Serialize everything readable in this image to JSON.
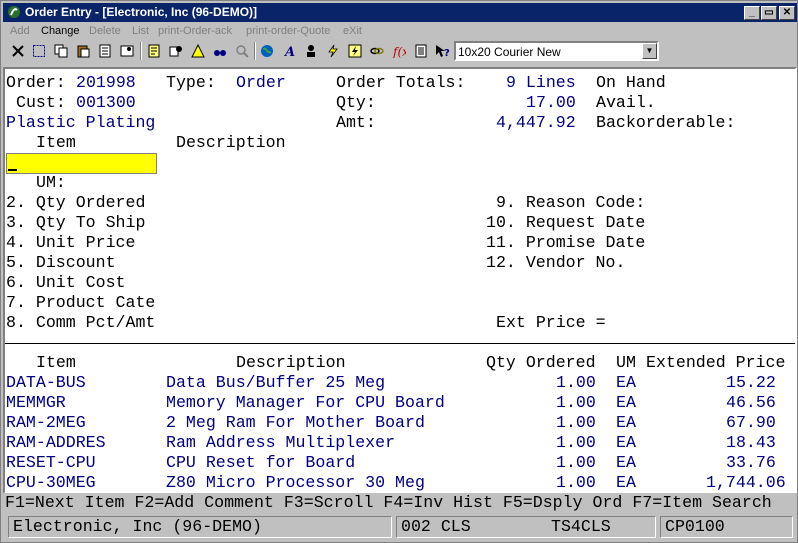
{
  "window": {
    "title": "Order Entry - [Electronic, Inc (96-DEMO)]",
    "controls": {
      "minimize": "_",
      "restore": "▭",
      "close": "✕"
    }
  },
  "menu": {
    "items": [
      {
        "label": "Add",
        "enabled": false
      },
      {
        "label": "Change",
        "enabled": true
      },
      {
        "label": "Delete",
        "enabled": false
      },
      {
        "label": "List",
        "enabled": false
      },
      {
        "label": "print-Order-ack",
        "enabled": false
      },
      {
        "label": "print-order-Quote",
        "enabled": false
      },
      {
        "label": "eXit",
        "enabled": false
      }
    ]
  },
  "toolbar": {
    "icons": [
      "cut-icon",
      "select-icon",
      "copy-icon",
      "paste-icon",
      "clipboard-icon",
      "settings-icon",
      "notes-icon",
      "user-icon",
      "alert-icon",
      "search-icon",
      "binoculars-icon",
      "earth-icon",
      "font-icon",
      "users-icon",
      "lightning-icon",
      "lightning2-icon",
      "link-icon",
      "function-icon",
      "document-icon",
      "help-icon"
    ],
    "font_select": {
      "value": "10x20 Courier New",
      "arrow": "▼"
    }
  },
  "order": {
    "order_label": "Order:",
    "order_number": "201998",
    "type_label": "Type:",
    "type_value": "Order",
    "totals_label": "Order Totals:",
    "lines_value": "9 Lines",
    "on_hand_label": "On Hand",
    "cust_label": "Cust:",
    "cust_number": "001300",
    "qty_label": "Qty:",
    "qty_value": "17.00",
    "avail_label": "Avail.",
    "cust_name": "Plastic Plating",
    "amt_label": "Amt:",
    "amt_value": "4,447.92",
    "backorderable_label": "Backorderable:"
  },
  "entry_form": {
    "item_header": "Item",
    "description_header": "Description",
    "item_value": "",
    "um_label": "UM:",
    "left_fields": [
      "2. Qty Ordered",
      "3. Qty To Ship",
      "4. Unit Price",
      "5. Discount",
      "6. Unit Cost",
      "7. Product Cate",
      "8. Comm Pct/Amt"
    ],
    "right_fields": [
      " 9. Reason Code:",
      "10. Request Date",
      "11. Promise Date",
      "12. Vendor No."
    ],
    "ext_price_label": "Ext Price ="
  },
  "lines_table": {
    "headers": {
      "item": "Item",
      "description": "Description",
      "qty": "Qty Ordered",
      "um": "UM",
      "price": "Extended Price"
    },
    "rows": [
      {
        "item": "DATA-BUS",
        "description": "Data Bus/Buffer 25 Meg",
        "qty": "1.00",
        "um": "EA",
        "price": "15.22"
      },
      {
        "item": "MEMMGR",
        "description": "Memory Manager For CPU Board",
        "qty": "1.00",
        "um": "EA",
        "price": "46.56"
      },
      {
        "item": "RAM-2MEG",
        "description": "2 Meg Ram For Mother Board",
        "qty": "1.00",
        "um": "EA",
        "price": "67.90"
      },
      {
        "item": "RAM-ADDRES",
        "description": "Ram Address Multiplexer",
        "qty": "1.00",
        "um": "EA",
        "price": "18.43"
      },
      {
        "item": "RESET-CPU",
        "description": "CPU Reset for Board",
        "qty": "1.00",
        "um": "EA",
        "price": "33.76"
      },
      {
        "item": "CPU-30MEG",
        "description": "Z80 Micro Processor 30 Meg",
        "qty": "1.00",
        "um": "EA",
        "price": "1,744.06"
      }
    ]
  },
  "function_keys": "F1=Next Item F2=Add Comment F3=Scroll F4=Inv Hist F5=Dsply Ord F7=Item Search",
  "status": {
    "company": "Electronic, Inc (96-DEMO)",
    "terminal": "002 CLS",
    "session": "TS4CLS",
    "program": "CP0100"
  }
}
